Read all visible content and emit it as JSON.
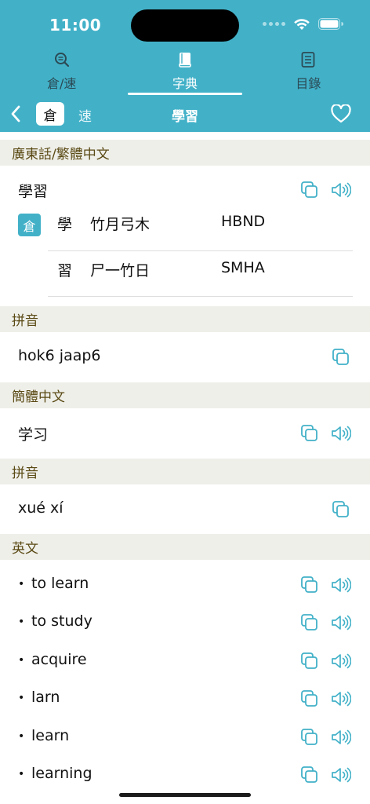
{
  "status": {
    "time": "11:00"
  },
  "tabs": [
    {
      "label": "倉/速",
      "icon": "magnifier-icon"
    },
    {
      "label": "字典",
      "icon": "book-icon"
    },
    {
      "label": "目錄",
      "icon": "list-icon"
    }
  ],
  "navbar": {
    "seg_active": "倉",
    "seg_other": "速",
    "title": "學習"
  },
  "sections": {
    "cantonese_header": "廣東話/繁體中文",
    "word": "學習",
    "cangjie_badge": "倉",
    "cangjie": [
      {
        "char": "學",
        "radicals": "竹月弓木",
        "code": "HBND"
      },
      {
        "char": "習",
        "radicals": "尸一竹日",
        "code": "SMHA"
      }
    ],
    "jyutping_header": "拼音",
    "jyutping": "hok6 jaap6",
    "simplified_header": "簡體中文",
    "simplified": "学习",
    "pinyin_header": "拼音",
    "pinyin": "xué xí",
    "english_header": "英文",
    "english": [
      "to learn",
      "to study",
      "acquire",
      "larn",
      "learn",
      "learning"
    ]
  },
  "colors": {
    "accent": "#42b1c8",
    "section_bg": "#efefea",
    "section_text": "#5a4a14"
  }
}
